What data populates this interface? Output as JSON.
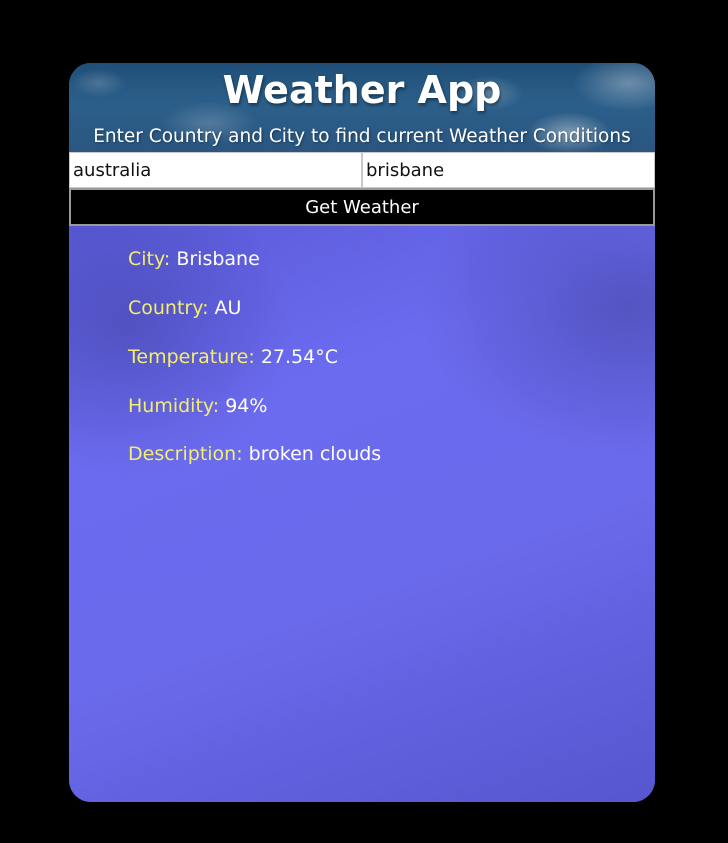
{
  "header": {
    "title": "Weather App",
    "subtitle": "Enter Country and City to find current Weather Conditions"
  },
  "form": {
    "country_value": "australia",
    "city_value": "brisbane",
    "button_label": "Get Weather"
  },
  "results": [
    {
      "label": "City:",
      "value": "Brisbane"
    },
    {
      "label": "Country:",
      "value": "AU"
    },
    {
      "label": "Temperature:",
      "value": "27.54°C"
    },
    {
      "label": "Humidity:",
      "value": "94%"
    },
    {
      "label": "Description:",
      "value": "broken clouds"
    }
  ],
  "colors": {
    "label": "#f3ee6e",
    "panel": "#6a6ae8",
    "button": "#000000"
  }
}
